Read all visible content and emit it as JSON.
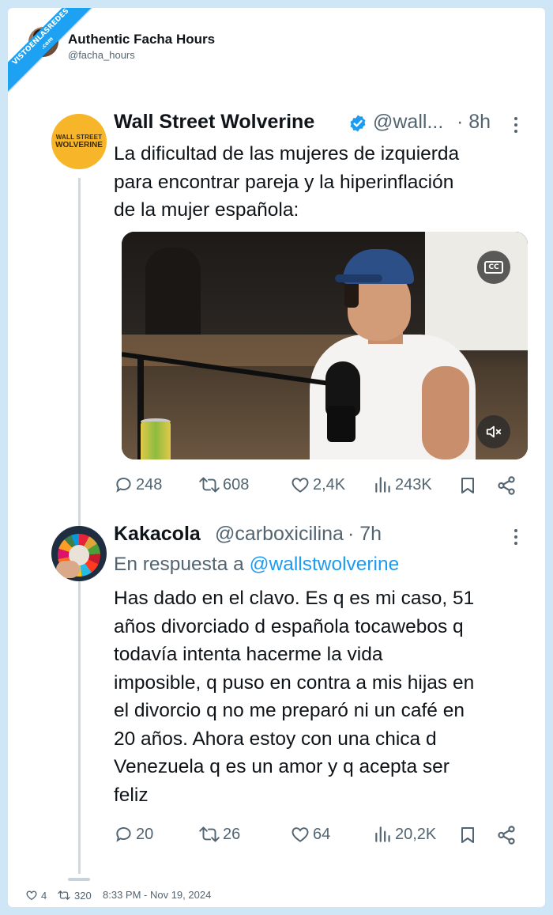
{
  "watermark": {
    "line1": "VISTOENLASREDES",
    "line2": ".com"
  },
  "outer": {
    "name": "Authentic Facha Hours",
    "handle": "@facha_hours"
  },
  "tweet1": {
    "avatar_text_line1": "WALL STREET",
    "avatar_text_line2": "WOLVERINE",
    "name": "Wall Street Wolverine",
    "handle": "@wall...",
    "time": "· 8h",
    "lines": [
      "La dificultad de las mujeres de izquierda",
      "para encontrar pareja y la hiperinflación",
      "de la mujer española:"
    ],
    "media": {
      "cc_label": "CC"
    },
    "stats": {
      "replies": "248",
      "reposts": "608",
      "likes": "2,4K",
      "views": "243K"
    }
  },
  "tweet2": {
    "name": "Kakacola",
    "handle": "@carboxicilina",
    "time": "· 7h",
    "reply_prefix": "En respuesta a",
    "reply_handle": "@wallstwolverine",
    "lines": [
      "Has dado en el clavo. Es q es mi caso, 51",
      "años divorciado d española tocawebos q",
      "todavía intenta hacerme la vida",
      "imposible, q puso en contra a mis hijas en",
      "el divorcio q no me preparó ni un café en",
      "20 años. Ahora estoy con una chica d",
      "Venezuela q es un amor y q acepta ser",
      "feliz"
    ],
    "stats": {
      "replies": "20",
      "reposts": "26",
      "likes": "64",
      "views": "20,2K"
    }
  },
  "footer": {
    "likes": "4",
    "reposts": "320",
    "timestamp": "8:33 PM - Nov 19, 2024"
  },
  "colors": {
    "frame": "#cfe6f7",
    "accent": "#1d9bf0",
    "muted": "#536471",
    "ribbon": "#1da1f2",
    "brand_avatar": "#f7b52a"
  }
}
